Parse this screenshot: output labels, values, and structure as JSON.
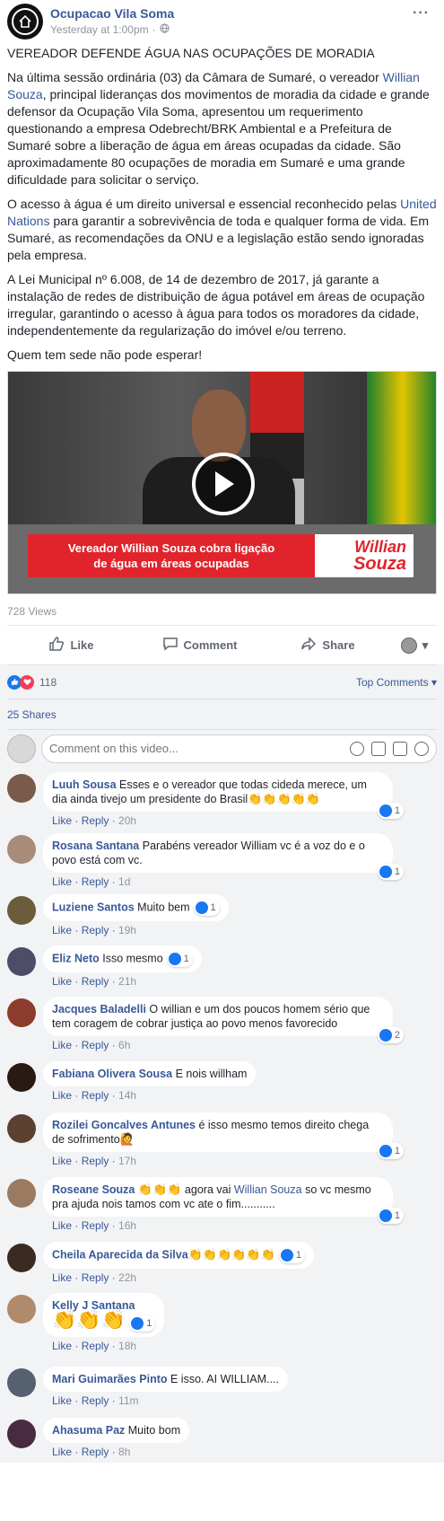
{
  "post": {
    "page_name": "Ocupacao Vila Soma",
    "time": "Yesterday at 1:00pm",
    "title": "VEREADOR DEFENDE ÁGUA NAS OCUPAÇÕES DE MORADIA",
    "p1_a": "Na última sessão ordinária (03) da Câmara de Sumaré, o vereador ",
    "p1_link": "Willian Souza",
    "p1_b": ", principal lideranças dos movimentos de moradia da cidade e grande defensor da Ocupação Vila Soma, apresentou um requerimento questionando a empresa Odebrecht/BRK Ambiental e a Prefeitura de Sumaré sobre a liberação de água em áreas ocupadas da cidade. São aproximadamente 80 ocupações de moradia em Sumaré e uma grande dificuldade para solicitar o serviço.",
    "p2_a": "O acesso à água é um direito universal e essencial reconhecido pelas ",
    "p2_link": "United Nations",
    "p2_b": " para garantir a sobrevivência de toda e qualquer forma de vida. Em Sumaré, as recomendações da ONU e a legislação estão sendo ignoradas pela empresa.",
    "p3": "A Lei Municipal nº 6.008, de 14 de dezembro de 2017, já garante a instalação de redes de distribuição de água potável em áreas de ocupação irregular, garantindo o acesso à água para todos os moradores da cidade, independentemente da regularização do imóvel e/ou terreno.",
    "p4": "Quem tem sede não pode esperar!",
    "video_banner_1": "Vereador Willian Souza cobra ligação",
    "video_banner_2": "de água em áreas ocupadas",
    "video_logo_1": "Willian",
    "video_logo_2": "Souza",
    "views": "728 Views"
  },
  "actions": {
    "like": "Like",
    "comment": "Comment",
    "share": "Share"
  },
  "reactions": {
    "count": "118",
    "top_comments": "Top Comments ▾",
    "shares": "25 Shares"
  },
  "comment_input": {
    "placeholder": "Comment on this video..."
  },
  "comments": [
    {
      "name": "Luuh Sousa",
      "text": "Esses e o vereador que todas cideda merece, um dia ainda tivejo um presidente do Brasil",
      "emoji": "👏👏👏👏👏",
      "like": "Like",
      "reply": "Reply",
      "time": "20h",
      "react": "1",
      "avatar_color": "#7a5a48"
    },
    {
      "name": "Rosana Santana",
      "text": "Parabéns vereador William vc é a voz do e o povo está com vc.",
      "emoji": "",
      "like": "Like",
      "reply": "Reply",
      "time": "1d",
      "react": "1",
      "avatar_color": "#a78c7a"
    },
    {
      "name": "Luziene Santos",
      "text": "Muito bem",
      "emoji": "",
      "like": "Like",
      "reply": "Reply",
      "time": "19h",
      "react": "1",
      "avatar_color": "#6b5d3c"
    },
    {
      "name": "Eliz Neto",
      "text": "Isso mesmo",
      "emoji": "",
      "like": "Like",
      "reply": "Reply",
      "time": "21h",
      "react": "1",
      "avatar_color": "#4d4d6a"
    },
    {
      "name": "Jacques Baladelli",
      "text": "O willian e um dos poucos homem sério que tem coragem de cobrar justiça ao povo menos favorecido",
      "emoji": "",
      "like": "Like",
      "reply": "Reply",
      "time": "6h",
      "react": "2",
      "avatar_color": "#8c3c2c"
    },
    {
      "name": "Fabiana Olivera Sousa",
      "text": "E nois willham",
      "emoji": "",
      "like": "Like",
      "reply": "Reply",
      "time": "14h",
      "react": "",
      "avatar_color": "#2a1a14"
    },
    {
      "name": "Rozilei Goncalves Antunes",
      "text": "é isso mesmo temos direito chega de sofrimento",
      "emoji": "🙋",
      "like": "Like",
      "reply": "Reply",
      "time": "17h",
      "react": "1",
      "avatar_color": "#5c4030"
    },
    {
      "name": "Roseane Souza",
      "text": "agora vai",
      "link": "Willian Souza",
      "text2": "so vc mesmo pra ajuda nois tamos com vc ate o fim...........",
      "emoji_name": "👏👏👏",
      "like": "Like",
      "reply": "Reply",
      "time": "16h",
      "react": "1",
      "avatar_color": "#9a7a60"
    },
    {
      "name": "Cheila Aparecida da Silva",
      "text": "",
      "emoji": "👏👏👏👏👏👏",
      "like": "Like",
      "reply": "Reply",
      "time": "22h",
      "react": "1",
      "avatar_color": "#3a2a22"
    },
    {
      "name": "Kelly J Santana",
      "text": "",
      "emoji": "👏👏👏",
      "like": "Like",
      "reply": "Reply",
      "time": "18h",
      "react": "1",
      "avatar_color": "#b08a6a"
    },
    {
      "name": "Mari Guimarães Pinto",
      "text": "E isso. AI WILLIAM....",
      "emoji": "",
      "like": "Like",
      "reply": "Reply",
      "time": "11m",
      "react": "",
      "avatar_color": "#556070"
    },
    {
      "name": "Ahasuma Paz",
      "text": "Muito bom",
      "emoji": "",
      "like": "Like",
      "reply": "Reply",
      "time": "8h",
      "react": "",
      "avatar_color": "#4a2a40"
    }
  ]
}
